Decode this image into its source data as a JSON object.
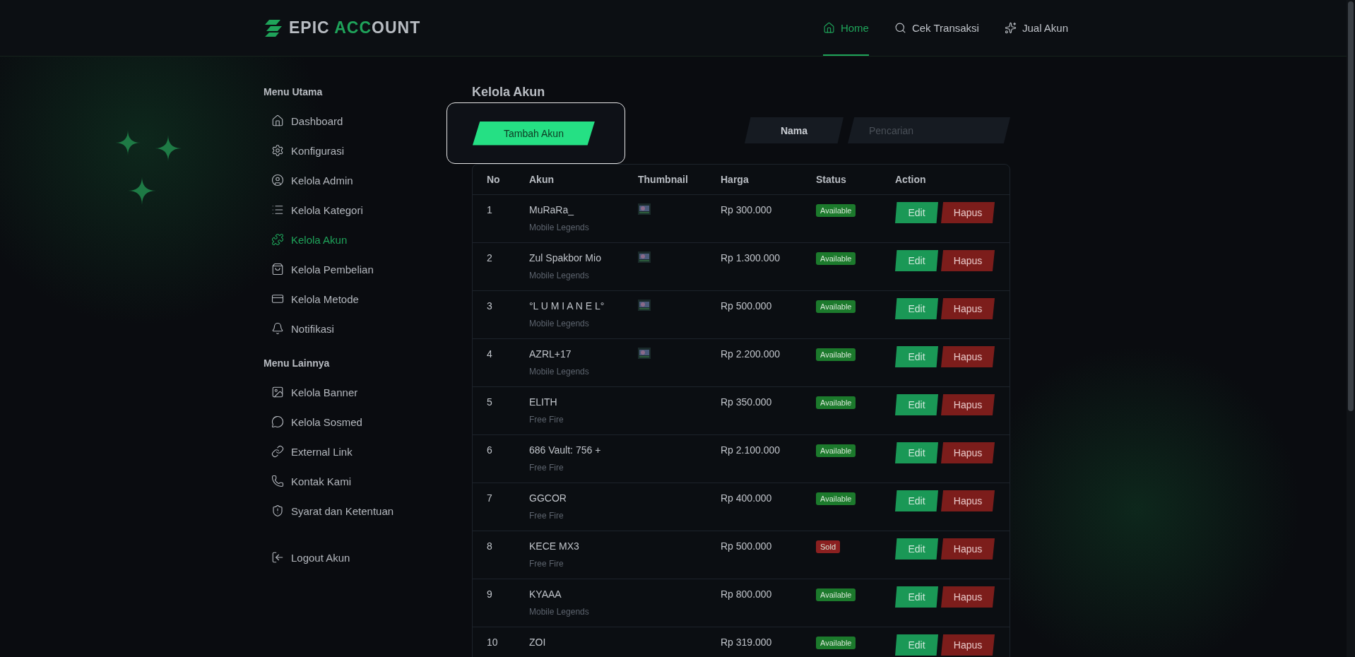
{
  "logo": {
    "part_1": "EPIC ",
    "part_2": "ACC",
    "part_3": "OUNT"
  },
  "nav": [
    {
      "label": "Home",
      "selected": true
    },
    {
      "label": "Cek Transaksi",
      "selected": false
    },
    {
      "label": "Jual Akun",
      "selected": false
    }
  ],
  "sidebar": {
    "sections": [
      {
        "title": "Menu Utama",
        "items": [
          {
            "label": "Dashboard",
            "selected": false
          },
          {
            "label": "Konfigurasi",
            "selected": false
          },
          {
            "label": "Kelola Admin",
            "selected": false
          },
          {
            "label": "Kelola Kategori",
            "selected": false
          },
          {
            "label": "Kelola Akun",
            "selected": true
          },
          {
            "label": "Kelola Pembelian",
            "selected": false
          },
          {
            "label": "Kelola Metode",
            "selected": false
          },
          {
            "label": "Notifikasi",
            "selected": false
          }
        ]
      },
      {
        "title": "Menu Lainnya",
        "items": [
          {
            "label": "Kelola Banner",
            "selected": false
          },
          {
            "label": "Kelola Sosmed",
            "selected": false
          },
          {
            "label": "External Link",
            "selected": false
          },
          {
            "label": "Kontak Kami",
            "selected": false
          },
          {
            "label": "Syarat dan Ketentuan",
            "selected": false
          }
        ]
      }
    ],
    "logout": "Logout Akun"
  },
  "page_title": "Kelola Akun",
  "add_button": "Tambah Akun",
  "search": {
    "filter": "Nama",
    "placeholder": "Pencarian"
  },
  "table": {
    "columns": [
      "No",
      "Akun",
      "Thumbnail",
      "Harga",
      "Status",
      "Action"
    ],
    "rows": [
      {
        "no": "1",
        "name": "MuRaRa_",
        "game": "Mobile Legends",
        "price": "Rp 300.000",
        "status": {
          "label": "Available",
          "kind": "available"
        },
        "edit": "Edit",
        "delete": "Hapus"
      },
      {
        "no": "2",
        "name": "Zul Spakbor Mio",
        "game": "Mobile Legends",
        "price": "Rp 1.300.000",
        "status": {
          "label": "Available",
          "kind": "available"
        },
        "edit": "Edit",
        "delete": "Hapus"
      },
      {
        "no": "3",
        "name": "°L U M I A N E L°",
        "game": "Mobile Legends",
        "price": "Rp 500.000",
        "status": {
          "label": "Available",
          "kind": "available"
        },
        "edit": "Edit",
        "delete": "Hapus"
      },
      {
        "no": "4",
        "name": "AZRL+17",
        "game": "Mobile Legends",
        "price": "Rp 2.200.000",
        "status": {
          "label": "Available",
          "kind": "available"
        },
        "edit": "Edit",
        "delete": "Hapus"
      },
      {
        "no": "5",
        "name": "ELITH",
        "game": "Free Fire",
        "price": "Rp 350.000",
        "status": {
          "label": "Available",
          "kind": "available"
        },
        "edit": "Edit",
        "delete": "Hapus"
      },
      {
        "no": "6",
        "name": "686 Vault: 756 +",
        "game": "Free Fire",
        "price": "Rp 2.100.000",
        "status": {
          "label": "Available",
          "kind": "available"
        },
        "edit": "Edit",
        "delete": "Hapus"
      },
      {
        "no": "7",
        "name": "GGCOR",
        "game": "Free Fire",
        "price": "Rp 400.000",
        "status": {
          "label": "Available",
          "kind": "available"
        },
        "edit": "Edit",
        "delete": "Hapus"
      },
      {
        "no": "8",
        "name": "KECE MX3",
        "game": "Free Fire",
        "price": "Rp 500.000",
        "status": {
          "label": "Sold",
          "kind": "sold"
        },
        "edit": "Edit",
        "delete": "Hapus"
      },
      {
        "no": "9",
        "name": "KYAAA",
        "game": "Mobile Legends",
        "price": "Rp 800.000",
        "status": {
          "label": "Available",
          "kind": "available"
        },
        "edit": "Edit",
        "delete": "Hapus"
      },
      {
        "no": "10",
        "name": "ZOI",
        "price": "Rp 319.000",
        "status": {
          "label": "Available",
          "kind": "available"
        },
        "edit": "Edit",
        "delete": "Hapus"
      }
    ]
  }
}
